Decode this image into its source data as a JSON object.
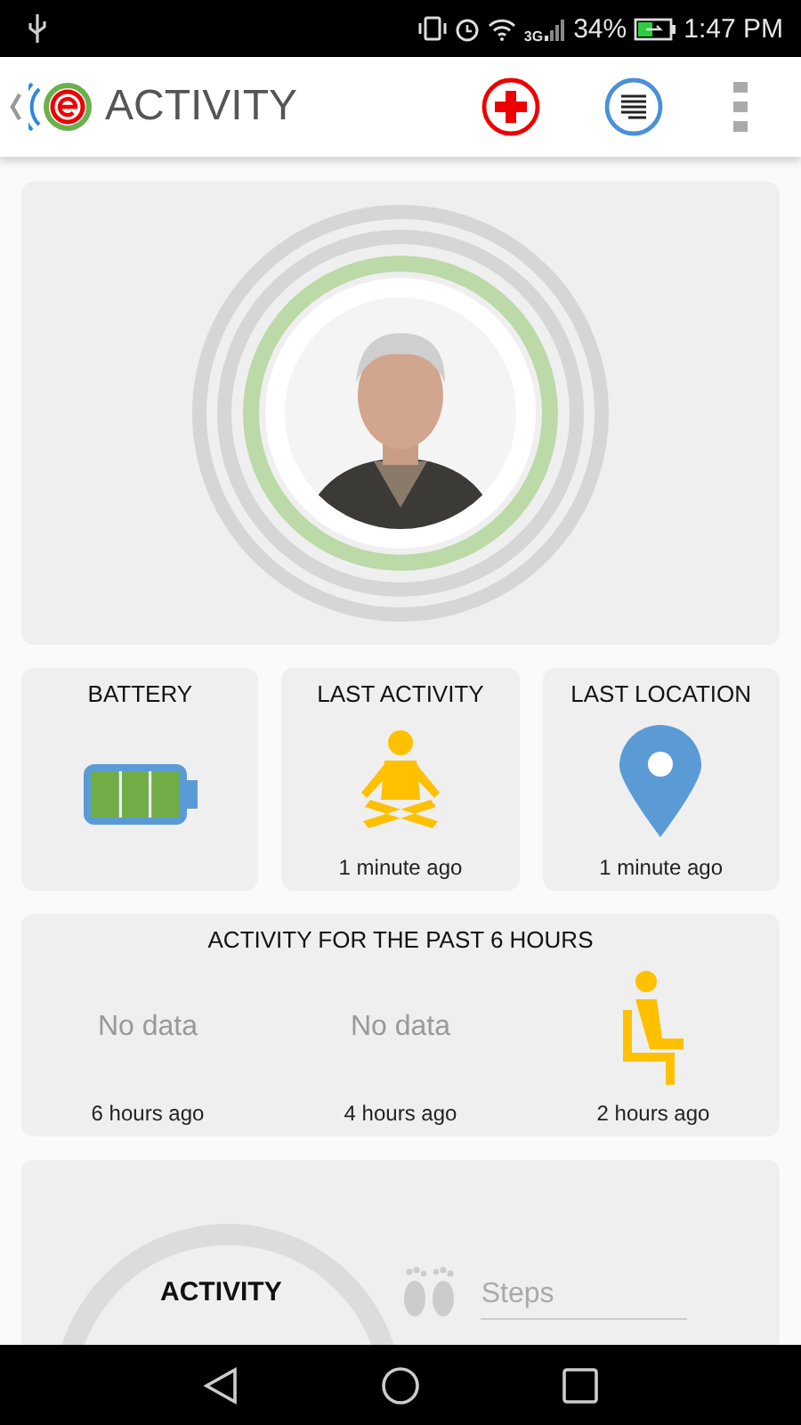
{
  "status_bar": {
    "network": "3G",
    "battery": "34%",
    "time": "1:47 PM"
  },
  "header": {
    "title": "ACTIVITY"
  },
  "status_cards": [
    {
      "kind": "battery",
      "title": "BATTERY",
      "level": 1
    },
    {
      "kind": "activity",
      "title": "LAST ACTIVITY",
      "time": "1 minute ago"
    },
    {
      "kind": "location",
      "title": "LAST LOCATION",
      "time": "1 minute ago"
    }
  ],
  "history": {
    "title": "ACTIVITY FOR THE PAST 6 HOURS",
    "slots": [
      {
        "kind": "text",
        "value": "No data",
        "time": "6 hours ago"
      },
      {
        "kind": "text",
        "value": "No data",
        "time": "4 hours ago"
      },
      {
        "kind": "sitting",
        "time": "2 hours ago"
      }
    ]
  },
  "summary": {
    "title": "ACTIVITY",
    "steps": {
      "placeholder": "Steps"
    }
  }
}
